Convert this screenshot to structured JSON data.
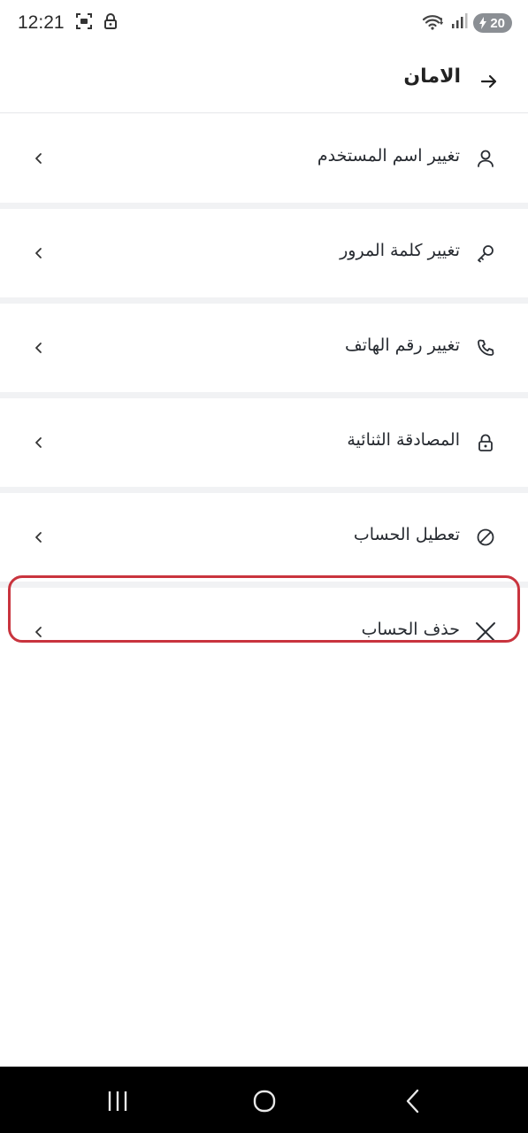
{
  "status_bar": {
    "time": "12:21",
    "battery_level": "20",
    "icons": [
      "screenshot-icon",
      "lock-icon",
      "wifi-icon",
      "signal-icon",
      "battery-icon"
    ]
  },
  "header": {
    "title": "الامان",
    "back_icon": "arrow-right-icon"
  },
  "menu": {
    "items": [
      {
        "label": "تغيير اسم المستخدم",
        "icon": "user-icon"
      },
      {
        "label": "تغيير كلمة المرور",
        "icon": "key-icon"
      },
      {
        "label": "تغيير رقم الهاتف",
        "icon": "phone-icon"
      },
      {
        "label": "المصادقة الثنائية",
        "icon": "lock-icon"
      },
      {
        "label": "تعطيل الحساب",
        "icon": "ban-icon"
      },
      {
        "label": "حذف الحساب",
        "icon": "close-icon"
      }
    ]
  },
  "colors": {
    "highlight": "#c9343e",
    "separator": "#f1f2f4",
    "text": "#262a30",
    "nav_bar": "#000000"
  },
  "nav_bar": {
    "buttons": [
      "recents-icon",
      "home-icon",
      "back-icon"
    ]
  }
}
